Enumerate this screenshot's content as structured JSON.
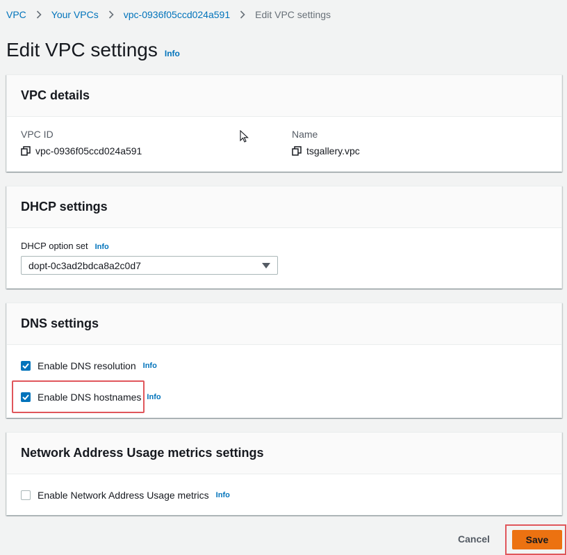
{
  "breadcrumb": {
    "items": [
      "VPC",
      "Your VPCs",
      "vpc-0936f05ccd024a591"
    ],
    "current": "Edit VPC settings"
  },
  "page": {
    "title": "Edit VPC settings",
    "info": "Info"
  },
  "vpc_details": {
    "heading": "VPC details",
    "vpc_id_label": "VPC ID",
    "vpc_id_value": "vpc-0936f05ccd024a591",
    "name_label": "Name",
    "name_value": "tsgallery.vpc"
  },
  "dhcp": {
    "heading": "DHCP settings",
    "option_set_label": "DHCP option set",
    "info": "Info",
    "selected": "dopt-0c3ad2bdca8a2c0d7"
  },
  "dns": {
    "heading": "DNS settings",
    "resolution_label": "Enable DNS resolution",
    "resolution_checked": true,
    "hostnames_label": "Enable DNS hostnames",
    "hostnames_checked": true,
    "info": "Info"
  },
  "nau": {
    "heading": "Network Address Usage metrics settings",
    "metrics_label": "Enable Network Address Usage metrics",
    "metrics_checked": false,
    "info": "Info"
  },
  "actions": {
    "cancel": "Cancel",
    "save": "Save"
  },
  "colors": {
    "link": "#0073bb",
    "primary_button": "#ec7211",
    "highlight": "#e0565b",
    "checkbox": "#0073bb"
  }
}
